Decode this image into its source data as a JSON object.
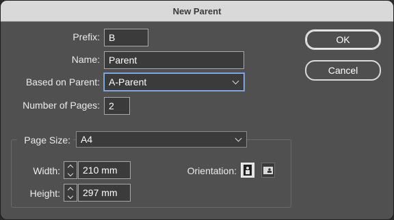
{
  "window": {
    "title": "New Parent"
  },
  "form": {
    "prefix_label": "Prefix:",
    "prefix_value": "B",
    "name_label": "Name:",
    "name_value": "Parent",
    "based_on_label": "Based on Parent:",
    "based_on_value": "A-Parent",
    "pages_label": "Number of Pages:",
    "pages_value": "2"
  },
  "page_size": {
    "label": "Page Size:",
    "value": "A4",
    "width_label": "Width:",
    "width_value": "210 mm",
    "height_label": "Height:",
    "height_value": "297 mm",
    "orientation_label": "Orientation:",
    "orientation_selected": "portrait"
  },
  "buttons": {
    "ok": "OK",
    "cancel": "Cancel"
  }
}
